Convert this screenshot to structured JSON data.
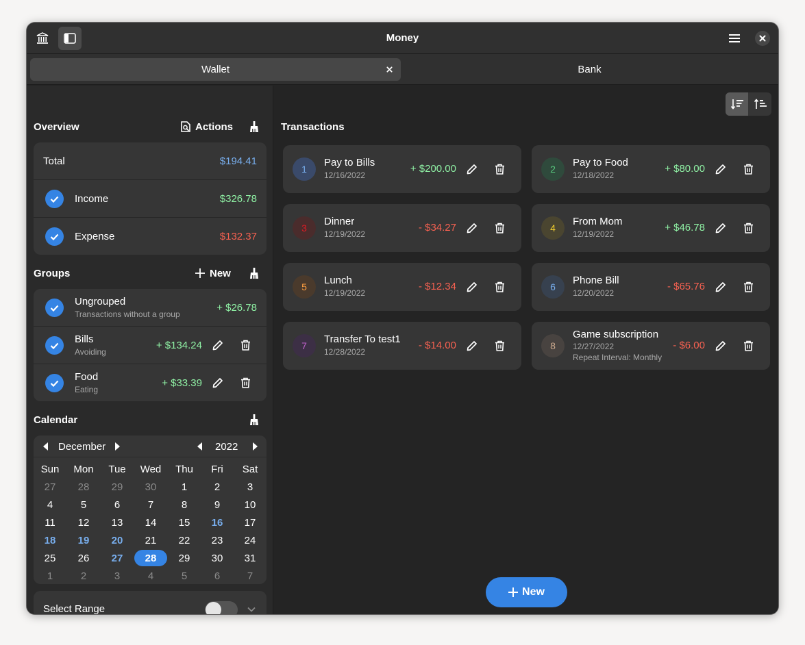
{
  "window": {
    "title": "Money"
  },
  "tabs": [
    {
      "label": "Wallet",
      "active": true
    },
    {
      "label": "Bank",
      "active": false
    }
  ],
  "overview": {
    "title": "Overview",
    "actions_label": "Actions",
    "total_label": "Total",
    "total_value": "$194.41",
    "income_label": "Income",
    "income_value": "$326.78",
    "expense_label": "Expense",
    "expense_value": "$132.37"
  },
  "groups": {
    "title": "Groups",
    "new_label": "New",
    "items": [
      {
        "name": "Ungrouped",
        "description": "Transactions without a group",
        "amount": "+ $26.78",
        "editable": false
      },
      {
        "name": "Bills",
        "description": "Avoiding",
        "amount": "+ $134.24",
        "editable": true
      },
      {
        "name": "Food",
        "description": "Eating",
        "amount": "+ $33.39",
        "editable": true
      }
    ]
  },
  "calendar": {
    "title": "Calendar",
    "month": "December",
    "year": "2022",
    "weekdays": [
      "Sun",
      "Mon",
      "Tue",
      "Wed",
      "Thu",
      "Fri",
      "Sat"
    ],
    "weeks": [
      [
        "27",
        "28",
        "29",
        "30",
        "1",
        "2",
        "3"
      ],
      [
        "4",
        "5",
        "6",
        "7",
        "8",
        "9",
        "10"
      ],
      [
        "11",
        "12",
        "13",
        "14",
        "15",
        "16",
        "17"
      ],
      [
        "18",
        "19",
        "20",
        "21",
        "22",
        "23",
        "24"
      ],
      [
        "25",
        "26",
        "27",
        "28",
        "29",
        "30",
        "31"
      ],
      [
        "1",
        "2",
        "3",
        "4",
        "5",
        "6",
        "7"
      ]
    ],
    "marked_days": [
      "16",
      "18",
      "19",
      "20",
      "27"
    ],
    "selected_day": "28"
  },
  "select_range": {
    "label": "Select Range",
    "enabled": false
  },
  "transactions": {
    "title": "Transactions",
    "new_label": "New",
    "items": [
      {
        "id": "1",
        "title": "Pay to Bills",
        "date": "12/16/2022",
        "amount": "+ $200.00",
        "type": "income",
        "badge_color": "#3a4a6a",
        "badge_text_color": "#78aeed"
      },
      {
        "id": "2",
        "title": "Pay to Food",
        "date": "12/18/2022",
        "amount": "+ $80.00",
        "type": "income",
        "badge_color": "#2f4a3c",
        "badge_text_color": "#57c77d"
      },
      {
        "id": "3",
        "title": "Dinner",
        "date": "12/19/2022",
        "amount": "- $34.27",
        "type": "expense",
        "badge_color": "#4a2c2c",
        "badge_text_color": "#e01b24"
      },
      {
        "id": "4",
        "title": "From Mom",
        "date": "12/19/2022",
        "amount": "+ $46.78",
        "type": "income",
        "badge_color": "#4a4530",
        "badge_text_color": "#f6d32d"
      },
      {
        "id": "5",
        "title": "Lunch",
        "date": "12/19/2022",
        "amount": "- $12.34",
        "type": "expense",
        "badge_color": "#4a3a2c",
        "badge_text_color": "#ff9f40"
      },
      {
        "id": "6",
        "title": "Phone Bill",
        "date": "12/20/2022",
        "amount": "- $65.76",
        "type": "expense",
        "badge_color": "#37414f",
        "badge_text_color": "#78aeed"
      },
      {
        "id": "7",
        "title": "Transfer To test1",
        "date": "12/28/2022",
        "amount": "- $14.00",
        "type": "expense",
        "badge_color": "#3c2f45",
        "badge_text_color": "#c061cb"
      },
      {
        "id": "8",
        "title": "Game subscription",
        "date": "12/27/2022",
        "extra": "Repeat Interval: Monthly",
        "amount": "- $6.00",
        "type": "expense",
        "badge_color": "#484340",
        "badge_text_color": "#cdab8f"
      }
    ]
  },
  "colors": {
    "accent": "#3584e4",
    "income": "#8ff0a4",
    "expense": "#f66151",
    "total": "#78aeed"
  },
  "icons": {
    "headerbar_left": [
      "bank-icon",
      "sidebar-toggle-icon"
    ],
    "headerbar_right": [
      "menu-icon",
      "close-icon"
    ],
    "section_clear": "broom-icon",
    "actions": "document-search-icon",
    "sort": [
      "sort-descending-icon",
      "sort-ascending-icon"
    ]
  }
}
